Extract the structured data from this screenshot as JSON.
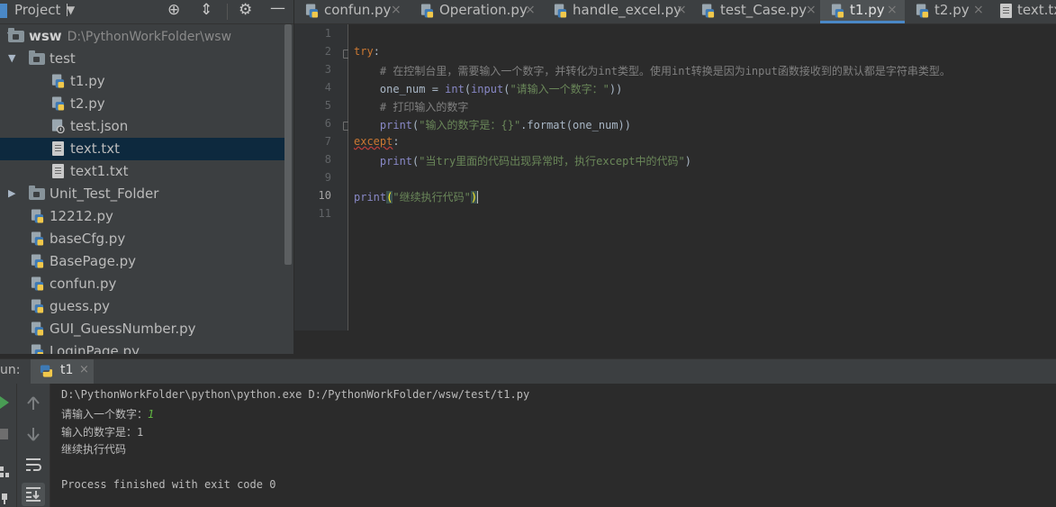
{
  "project_panel": {
    "title": "Project",
    "tree": [
      {
        "label": "wsw",
        "path": "D:\\PythonWorkFolder\\wsw",
        "type": "folder",
        "expanded": true
      },
      {
        "label": "test",
        "type": "folder",
        "expanded": true
      },
      {
        "label": "t1.py",
        "type": "python"
      },
      {
        "label": "t2.py",
        "type": "python"
      },
      {
        "label": "test.json",
        "type": "json"
      },
      {
        "label": "text.txt",
        "type": "text",
        "selected": true
      },
      {
        "label": "text1.txt",
        "type": "text"
      },
      {
        "label": "Unit_Test_Folder",
        "type": "folder",
        "expanded": false
      },
      {
        "label": "12212.py",
        "type": "python"
      },
      {
        "label": "baseCfg.py",
        "type": "python"
      },
      {
        "label": "BasePage.py",
        "type": "python"
      },
      {
        "label": "confun.py",
        "type": "python"
      },
      {
        "label": "guess.py",
        "type": "python"
      },
      {
        "label": "GUI_GuessNumber.py",
        "type": "python"
      },
      {
        "label": "LoginPage.py",
        "type": "python"
      }
    ]
  },
  "editor_tabs": [
    {
      "label": "confun.py",
      "close": "×"
    },
    {
      "label": "Operation.py",
      "close": "×"
    },
    {
      "label": "handle_excel.py",
      "close": "×"
    },
    {
      "label": "test_Case.py",
      "close": "×"
    },
    {
      "label": "t1.py",
      "close": "×",
      "active": true
    },
    {
      "label": "t2.py",
      "close": "×"
    },
    {
      "label": "text.txt",
      "close": ""
    }
  ],
  "editor": {
    "current_line": 10,
    "line_numbers": [
      "1",
      "2",
      "3",
      "4",
      "5",
      "6",
      "7",
      "8",
      "9",
      "10",
      "11"
    ],
    "code": {
      "l2_kw": "try",
      "l2_colon": ":",
      "l3_comment": "    # 在控制台里，需要输入一个数字，并转化为int类型。使用int转换是因为input函数接收到的默认都是字符串类型。",
      "l4_a": "    one_num = ",
      "l4_int": "int",
      "l4_b": "(",
      "l4_input": "input",
      "l4_c": "(",
      "l4_str": "\"请输入一个数字：\"",
      "l4_d": "))",
      "l5_comment": "    # 打印输入的数字",
      "l6_a": "    ",
      "l6_print": "print",
      "l6_b": "(",
      "l6_str": "\"输入的数字是：{}\"",
      "l6_c": ".format(one_num))",
      "l7_kw": "except",
      "l7_colon": ":",
      "l9_a": "    ",
      "l9_print": "print",
      "l9_b": "(",
      "l9_str": "\"当try里面的代码出现异常时，执行except中的代码\"",
      "l9_c": ")",
      "l10_print": "print",
      "l10_open": "(",
      "l10_str": "\"继续执行代码\"",
      "l10_close": ")"
    }
  },
  "run_panel": {
    "label": "un:",
    "tab_label": "t1",
    "tab_close": "×",
    "console": {
      "command": "D:\\PythonWorkFolder\\python\\python.exe D:/PythonWorkFolder/wsw/test/t1.py",
      "prompt": "请输入一个数字：",
      "user_input": "1",
      "output1": "输入的数字是：1",
      "output2": "继续执行代码",
      "finished": "Process finished with exit code 0"
    }
  },
  "icons": {
    "python": "python-file-icon",
    "folder": "folder-icon",
    "text": "text-file-icon",
    "json": "json-file-icon",
    "gear": "gear-icon",
    "locate": "locate-icon",
    "collapse": "collapse-icon",
    "hide": "hide-icon",
    "run": "run-icon",
    "stop": "stop-icon",
    "up": "up-arrow-icon",
    "down": "down-arrow-icon",
    "wrap": "soft-wrap-icon",
    "scroll_end": "scroll-to-end-icon"
  },
  "colors": {
    "accent": "#4a88c7",
    "selection": "#0d293e",
    "keyword": "#cc7832",
    "string": "#6a8759",
    "comment": "#808080",
    "builtin": "#8888c6",
    "user_input": "#62b543"
  }
}
